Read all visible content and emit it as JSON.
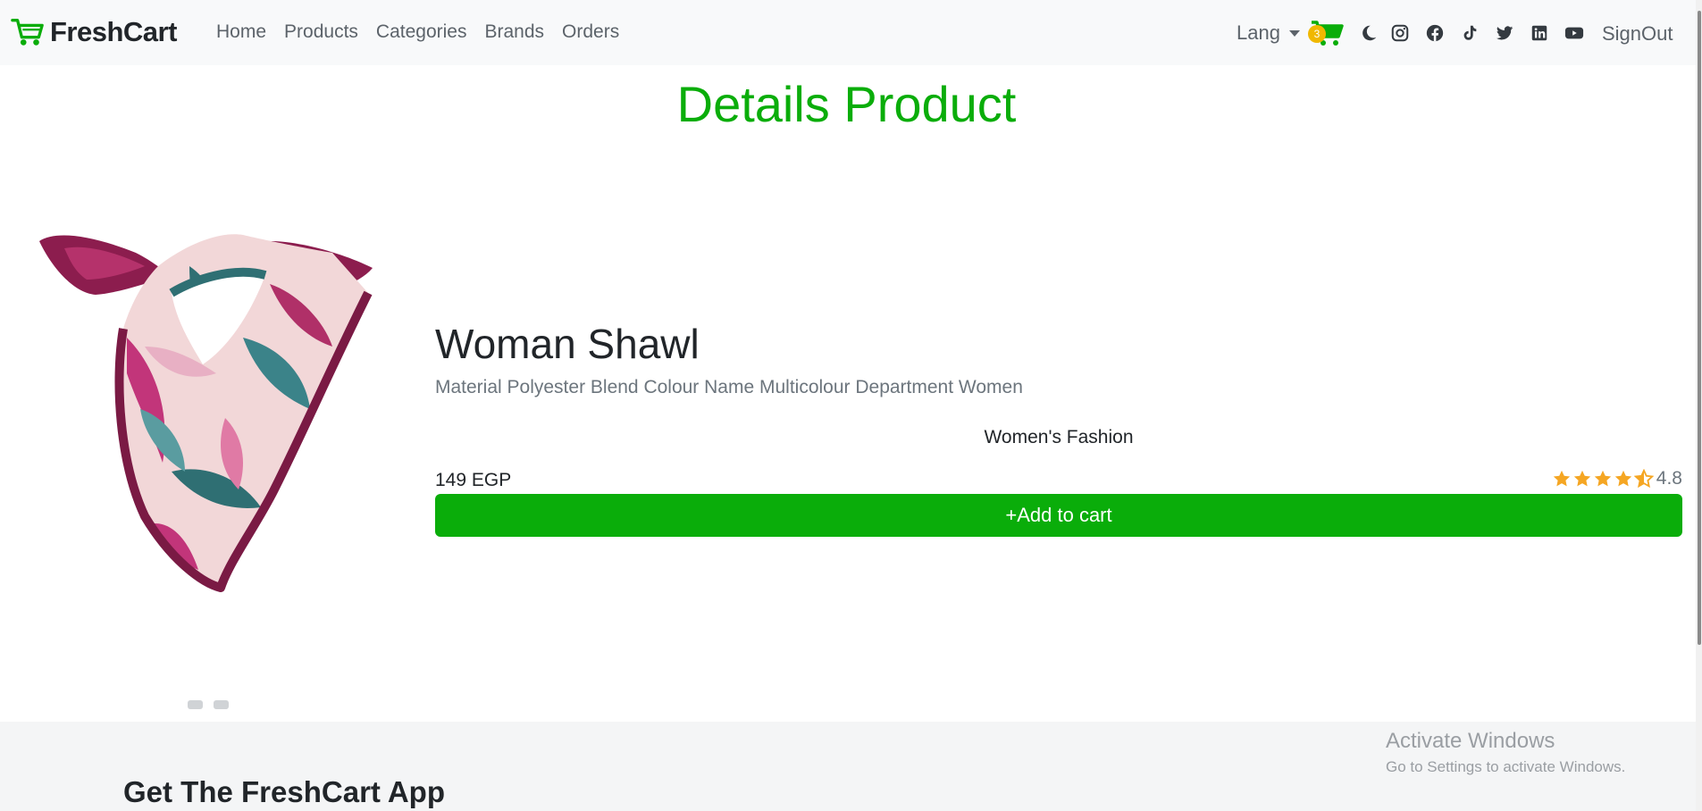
{
  "navbar": {
    "brand": "FreshCart",
    "links": [
      "Home",
      "Products",
      "Categories",
      "Brands",
      "Orders"
    ],
    "lang_label": "Lang",
    "cart_count": "3",
    "signout_label": "SignOut",
    "accent_color": "#0aad0a"
  },
  "main": {
    "title": "Details Product"
  },
  "product": {
    "name": "Woman Shawl",
    "description": "Material Polyester Blend Colour Name Multicolour Department Women",
    "category": "Women's Fashion",
    "price": "149 EGP",
    "rating": "4.8",
    "add_to_cart_label": "+Add to cart",
    "image_slides": 2
  },
  "footer": {
    "title": "Get The FreshCart App"
  },
  "watermark": {
    "title": "Activate Windows",
    "subtitle": "Go to Settings to activate Windows."
  }
}
